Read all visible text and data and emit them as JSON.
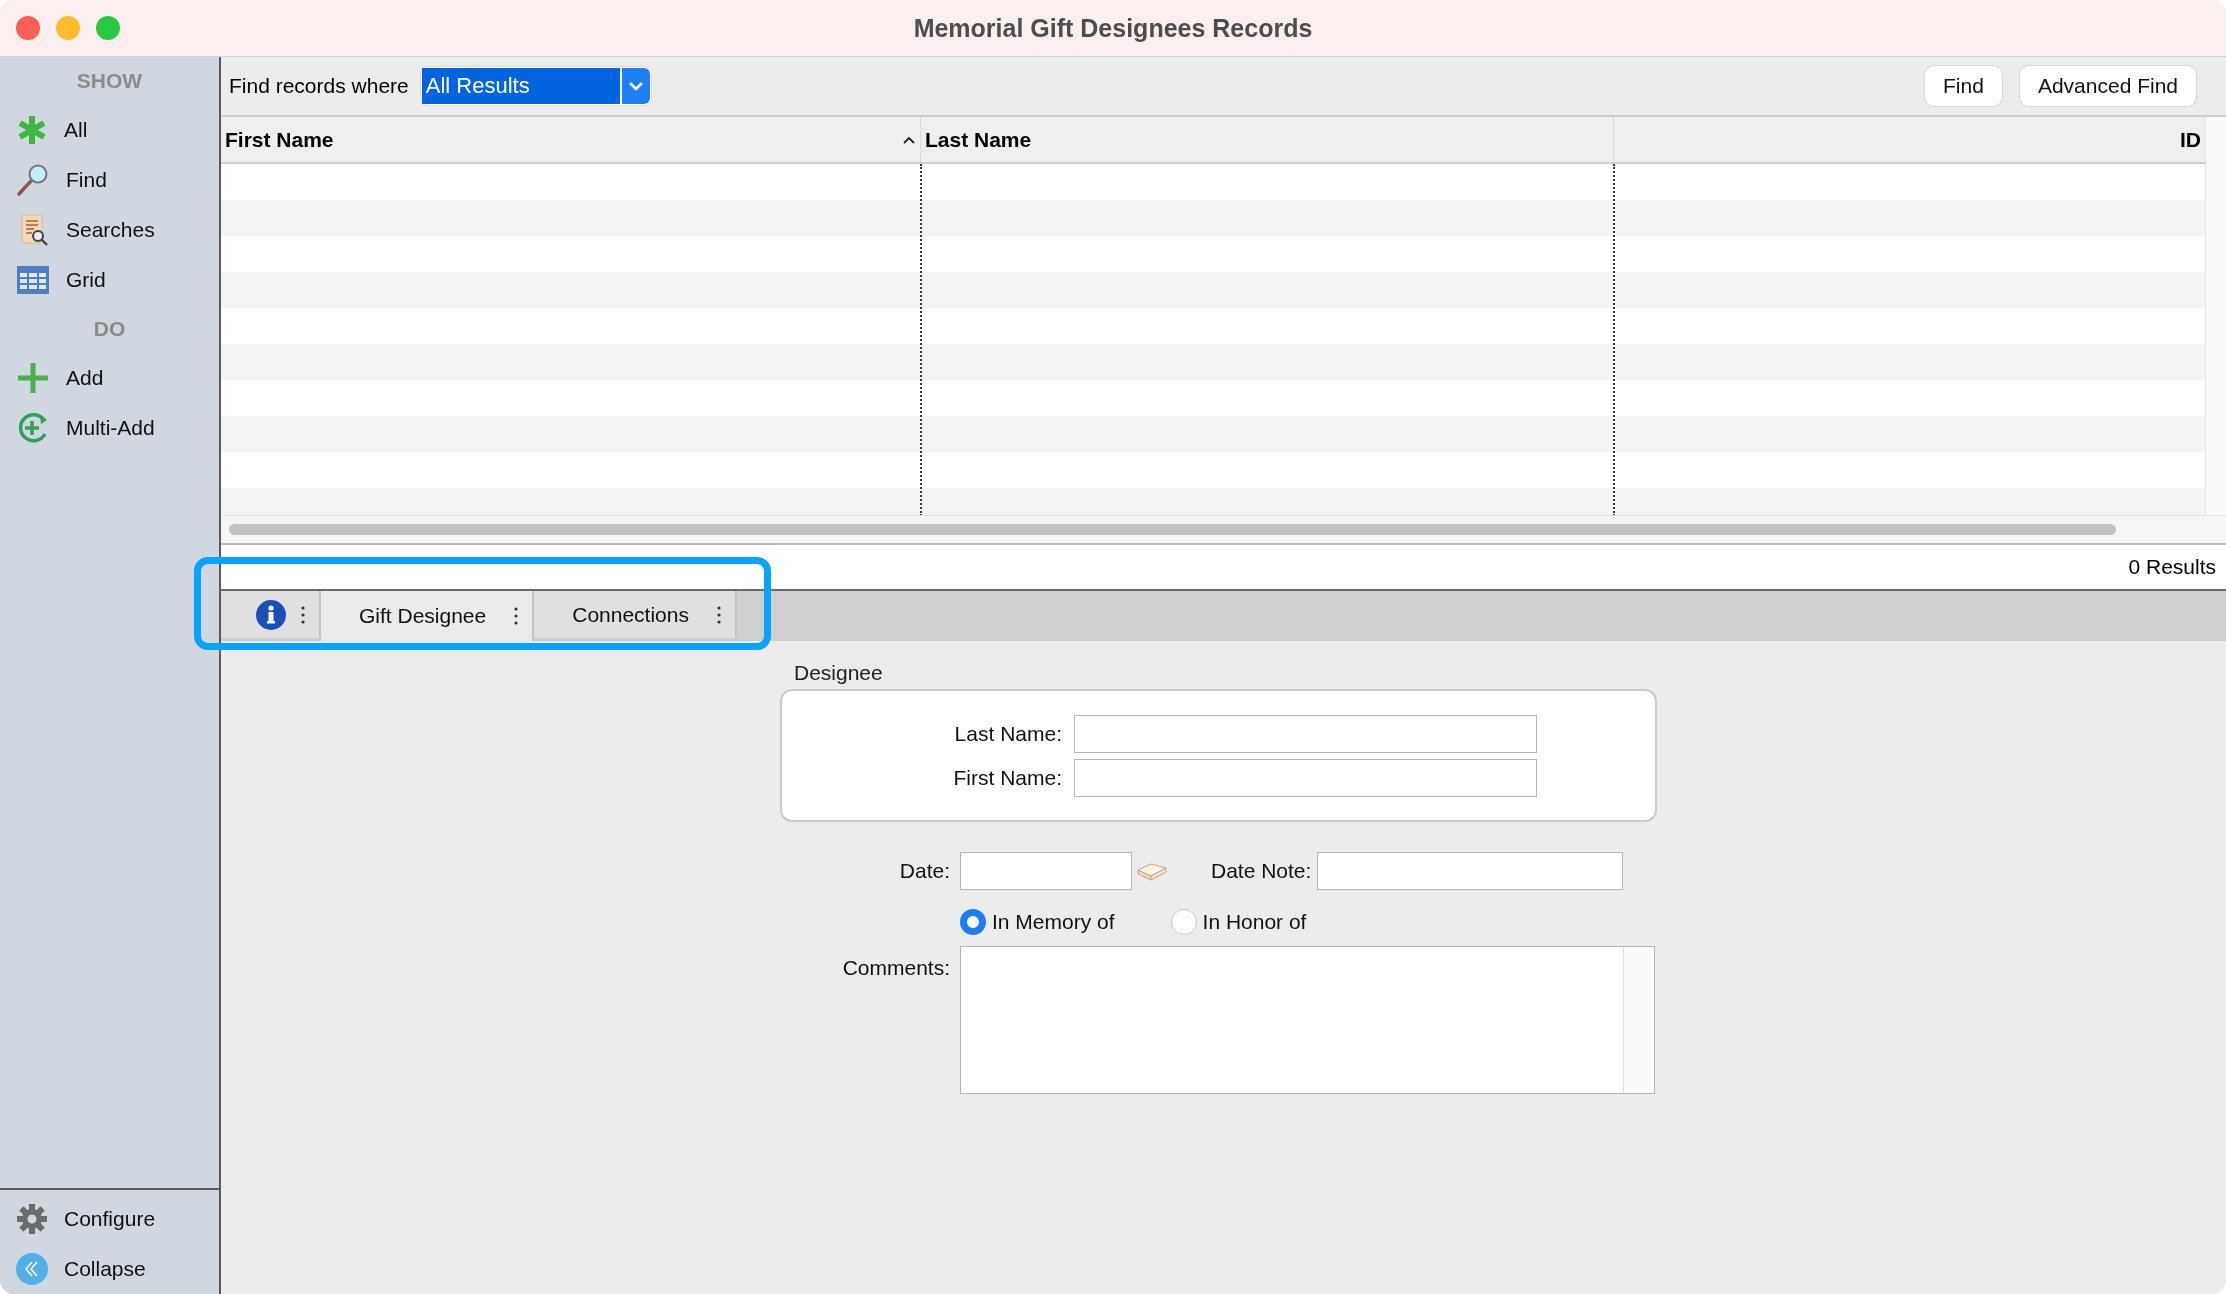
{
  "window": {
    "title": "Memorial Gift Designees Records"
  },
  "sidebar": {
    "sections": [
      {
        "heading": "SHOW",
        "items": [
          {
            "label": "All"
          },
          {
            "label": "Find"
          },
          {
            "label": "Searches"
          },
          {
            "label": "Grid"
          }
        ]
      },
      {
        "heading": "DO",
        "items": [
          {
            "label": "Add"
          },
          {
            "label": "Multi-Add"
          }
        ]
      }
    ],
    "footer_items": [
      {
        "label": "Configure"
      },
      {
        "label": "Collapse"
      }
    ]
  },
  "toolbar": {
    "label": "Find records where",
    "filter": {
      "value": "All Results"
    },
    "buttons": [
      "Find",
      "Advanced Find"
    ]
  },
  "table": {
    "columns": [
      {
        "label": "First Name",
        "sorted": true
      },
      {
        "label": "Last Name",
        "sorted": false
      },
      {
        "label": "ID",
        "sorted": false
      }
    ]
  },
  "results_count": "0 Results",
  "tabs": [
    {
      "kind": "info",
      "selected": false
    },
    {
      "kind": "text",
      "label": "Gift Designee",
      "selected": true
    },
    {
      "kind": "text",
      "label": "Connections",
      "selected": false
    }
  ],
  "form": {
    "group_title": "Designee",
    "fields": [
      {
        "label": "Last Name:"
      },
      {
        "label": "First Name:"
      }
    ],
    "date": {
      "label": "Date:"
    },
    "date_note": {
      "label": "Date Note:"
    },
    "radios": [
      {
        "label": "In Memory of",
        "selected": true
      },
      {
        "label": "In Honor of",
        "selected": false
      }
    ],
    "comments": {
      "label": "Comments:"
    }
  }
}
